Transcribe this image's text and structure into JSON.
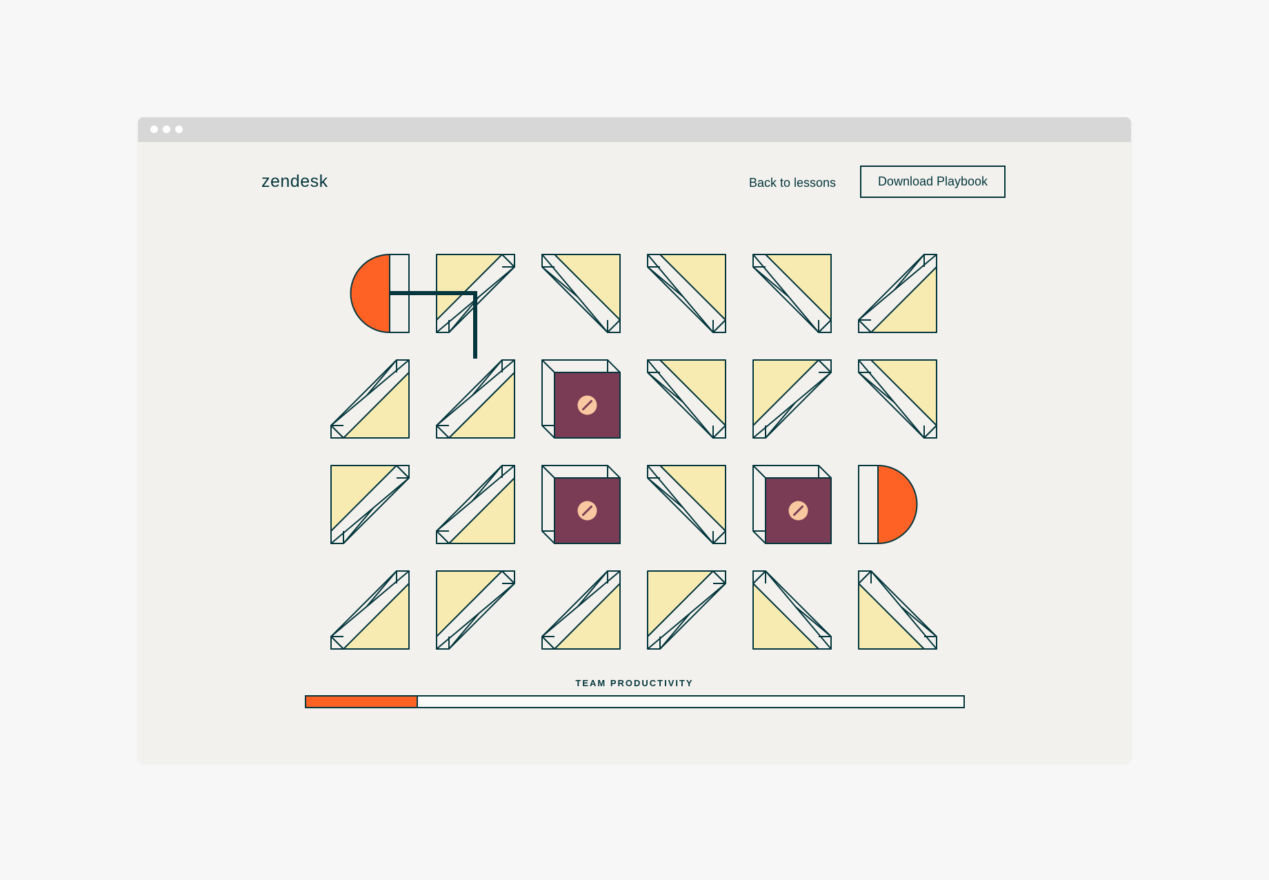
{
  "header": {
    "logo": "zendesk",
    "back_link": "Back to lessons",
    "cta": "Download Playbook"
  },
  "board": {
    "tiles": [
      [
        "terminal-left",
        "bend-east-south",
        "bend-south-west",
        "bend-south-west",
        "bend-south-west",
        "bend-north-south"
      ],
      [
        "bend-north-west",
        "bend-north-west",
        "blocked",
        "bend-south-west",
        "bend-east-south",
        "bend-south-west"
      ],
      [
        "bend-east-south",
        "bend-north-west",
        "blocked",
        "bend-south-west",
        "blocked",
        "terminal-right"
      ],
      [
        "bend-north-west",
        "bend-east-south",
        "bend-north-west",
        "bend-east-south",
        "bend-north-east",
        "bend-north-east"
      ]
    ],
    "connected_path": "from start terminal east then down into row 2 column 2"
  },
  "progress": {
    "label": "TEAM PRODUCTIVITY",
    "value": 0.17
  },
  "colors": {
    "ink": "#03363d",
    "tile_fill": "#f7ebb2",
    "tile_face": "#f3f1ed",
    "blocked": "#7a3b55",
    "blocked_badge": "#f8c8a0",
    "accent": "#ff6224",
    "page_bg": "#f7f7f7",
    "titlebar": "#d7d7d7"
  }
}
